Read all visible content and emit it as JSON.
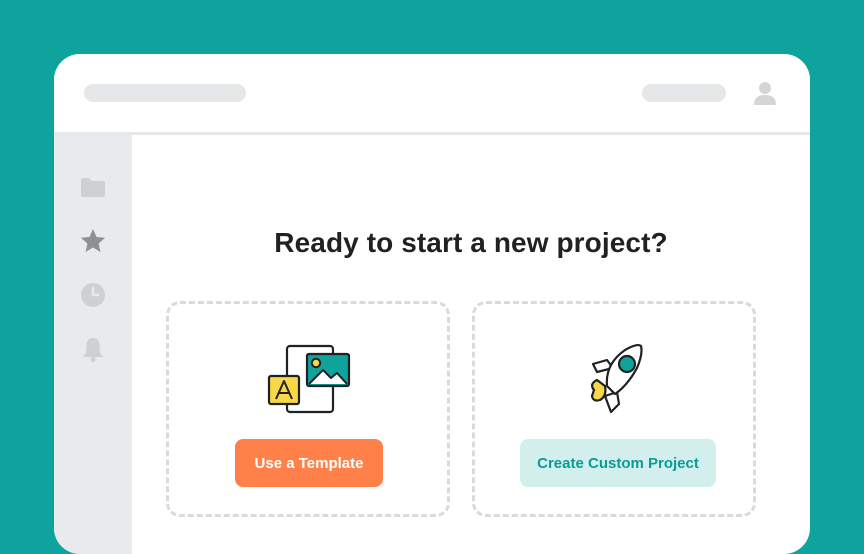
{
  "headline": "Ready to start a new project?",
  "options": {
    "template": {
      "button_label": "Use a Template",
      "icon": "template-images-icon"
    },
    "custom": {
      "button_label": "Create Custom Project",
      "icon": "rocket-icon"
    }
  },
  "sidebar": {
    "icons": [
      "folder-icon",
      "star-icon",
      "clock-icon",
      "bell-icon"
    ]
  },
  "header": {
    "icons": [
      "user-icon"
    ]
  },
  "colors": {
    "background": "#0fa39d",
    "primary_button": "#ff8149",
    "secondary_button": "#d2efed",
    "secondary_button_text": "#0b9b95",
    "accent_yellow": "#f7d847",
    "accent_teal": "#10a39c"
  }
}
